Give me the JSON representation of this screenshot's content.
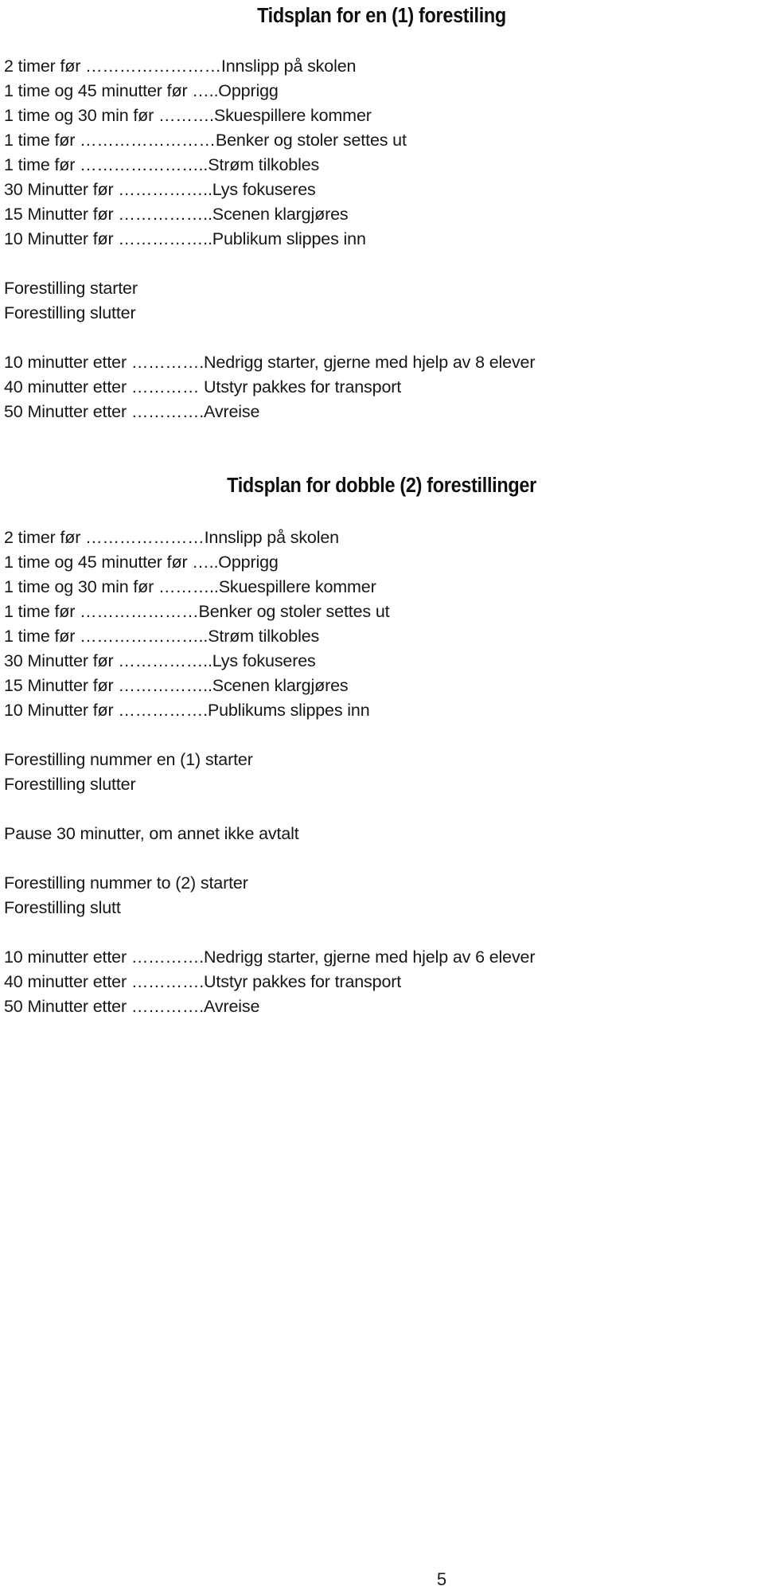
{
  "document": {
    "page_number": "5"
  },
  "sections": [
    {
      "id": "single-show",
      "title": "Tidsplan for en (1) forestiling",
      "groups": [
        {
          "id": "before-single",
          "lines": [
            "2 timer før ……………………Innslipp på skolen",
            "1 time og 45 minutter før …..Opprigg",
            "1 time og 30 min før ……….Skuespillere kommer",
            "1 time før ……………………Benker og stoler settes ut",
            "1 time før  …………………..Strøm tilkobles",
            "30 Minutter før ……………..Lys fokuseres",
            "15 Minutter før ……………..Scenen klargjøres",
            "10 Minutter før ……………..Publikum slippes inn"
          ]
        },
        {
          "id": "show-single",
          "lines": [
            "Forestilling starter",
            "Forestilling slutter"
          ]
        },
        {
          "id": "after-single",
          "lines": [
            "10 minutter etter ………….Nedrigg starter, gjerne med hjelp av 8 elever",
            "40 minutter etter ………… Utstyr pakkes for transport",
            "50 Minutter etter ………….Avreise"
          ]
        }
      ]
    },
    {
      "id": "double-show",
      "title": "Tidsplan for dobble (2) forestillinger",
      "groups": [
        {
          "id": "before-double",
          "lines": [
            "2 timer før …………………Innslipp på skolen",
            "1 time og 45 minutter før …..Opprigg",
            "1 time og 30 min før ………..Skuespillere kommer",
            "1 time før …………………Benker og stoler settes ut",
            "1 time før  …………………..Strøm tilkobles",
            "30 Minutter før ……………..Lys fokuseres",
            "15 Minutter før ……………..Scenen klargjøres",
            "10 Minutter før …………….Publikums slippes inn"
          ]
        },
        {
          "id": "show-one",
          "lines": [
            "Forestilling nummer en (1) starter",
            "Forestilling slutter"
          ]
        },
        {
          "id": "intermission",
          "lines": [
            "Pause 30 minutter, om annet ikke avtalt"
          ]
        },
        {
          "id": "show-two",
          "lines": [
            "Forestilling nummer to (2) starter",
            "Forestilling slutt"
          ]
        },
        {
          "id": "after-double",
          "lines": [
            "10 minutter etter ………….Nedrigg starter, gjerne med hjelp av 6 elever",
            "40 minutter etter ………….Utstyr pakkes for transport",
            "50 Minutter etter ………….Avreise"
          ]
        }
      ]
    }
  ]
}
